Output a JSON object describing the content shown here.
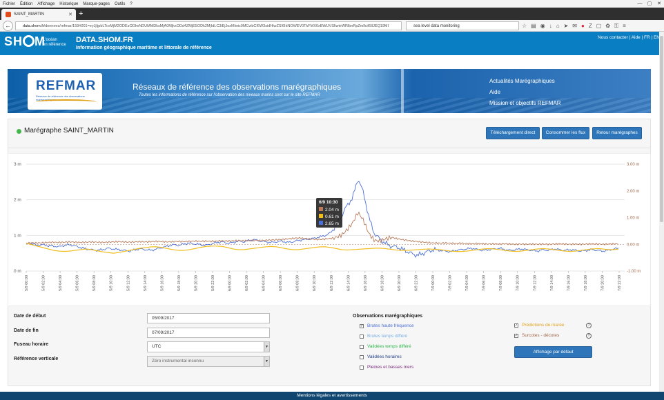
{
  "browser": {
    "menu": [
      "Fichier",
      "Édition",
      "Affichage",
      "Historique",
      "Marque-pages",
      "Outils",
      "?"
    ],
    "tab_title": "SAINT_MARTIN",
    "url_domain": "data.shom.fr",
    "url_rest": "/donnees/refmar/159#001=eyJjIjpbLTcvMjM2ODEzODIwNDUMMDksMjA0MjkxODd4ZMjE5ODk2MjIdLC3iEjJoxMlwic0MCvibCI6W3sidHlwZSI6IkNOWEV0TkFMX0xBWUVSIiwieWRlbnRpZmllciI6IlJEQ19MI",
    "search_value": "sea level data monitoring"
  },
  "site": {
    "logo_left": "SH",
    "logo_right": "M",
    "tagline_1": "L'océan",
    "tagline_2": "en référence",
    "title": "DATA.SHOM.FR",
    "subtitle": "Information géographique maritime et littorale de référence",
    "toplinks": "Nous contacter | Aide | FR | EN"
  },
  "banner": {
    "logo": "REFMAR",
    "logo_small": "Réseaux de référence des observations marégraphiques",
    "title": "Réseaux de référence des observations marégraphiques",
    "subtitle": "Toutes les informations de référence sur l'observation des niveaux marins sont sur le site REFMAR",
    "menu": [
      "Actualités Marégraphiques",
      "Aide",
      "Mission et objectifs REFMAR"
    ]
  },
  "station": {
    "title": "Marégraphe SAINT_MARTIN",
    "btn_download": "Téléchargement direct",
    "btn_flux": "Consommer les flux",
    "btn_back": "Retour marégraphes"
  },
  "chart_data": {
    "type": "line",
    "y_left_ticks": [
      "0 m",
      "1 m",
      "2 m",
      "3 m"
    ],
    "y_left_range": [
      0,
      3
    ],
    "y_right_ticks": [
      "-1.00 m",
      "0.00 m",
      "1.00 m",
      "2.00 m",
      "3.00 m"
    ],
    "y_right_range": [
      -1,
      3
    ],
    "x_ticks": [
      "5/9 00:00",
      "5/9 02:00",
      "5/9 04:00",
      "5/9 06:00",
      "5/9 08:00",
      "5/9 10:00",
      "5/9 12:00",
      "5/9 14:00",
      "5/9 16:00",
      "5/9 18:00",
      "5/9 20:00",
      "5/9 22:00",
      "6/9 00:00",
      "6/9 02:00",
      "6/9 04:00",
      "6/9 06:00",
      "6/9 08:00",
      "6/9 10:00",
      "6/9 12:00",
      "6/9 14:00",
      "6/9 16:00",
      "6/9 18:00",
      "6/9 20:00",
      "6/9 22:00",
      "7/9 00:00",
      "7/9 02:00",
      "7/9 04:00",
      "7/9 06:00",
      "7/9 08:00",
      "7/9 10:00",
      "7/9 12:00",
      "7/9 14:00",
      "7/9 16:00",
      "7/9 18:00",
      "7/9 20:00",
      "7/9 22:00"
    ],
    "series": [
      {
        "color": "#4a6fd8",
        "note": "hourly samples, left axis m",
        "values": [
          0.75,
          0.78,
          0.72,
          0.74,
          0.71,
          0.7,
          0.68,
          0.72,
          0.74,
          0.7,
          0.66,
          0.62,
          0.6,
          0.58,
          0.6,
          0.64,
          0.62,
          0.6,
          0.58,
          0.56,
          0.6,
          0.62,
          0.6,
          0.58,
          0.62,
          0.66,
          0.7,
          0.74,
          0.72,
          0.76,
          0.78,
          0.76,
          0.74,
          0.72,
          0.76,
          0.8,
          0.82,
          0.78,
          0.8,
          0.84,
          0.82,
          0.86,
          0.88,
          0.84,
          0.82,
          0.8,
          0.82,
          0.84,
          0.8,
          0.82,
          0.86,
          0.88,
          0.9,
          0.92,
          0.96,
          1.0,
          1.08,
          1.3,
          1.55,
          1.85,
          2.05,
          2.6,
          2.2,
          1.5,
          1.05,
          0.9,
          0.78,
          0.7,
          0.68,
          0.62,
          0.55,
          0.48,
          0.44,
          0.5,
          0.56,
          0.6,
          0.58,
          0.56,
          0.54,
          0.58,
          0.6,
          0.62,
          0.64,
          0.6,
          0.58,
          0.6,
          0.62,
          0.64,
          0.6,
          0.58,
          0.6,
          0.62,
          0.6,
          0.58,
          0.56,
          0.6,
          0.58,
          0.62,
          0.6,
          0.58,
          0.6,
          0.58,
          0.56,
          0.58,
          0.6,
          0.58,
          0.56,
          0.58,
          0.62,
          0.64
        ]
      },
      {
        "color": "#b87a5a",
        "note": "hourly samples, right axis m",
        "values": [
          0.04,
          0.06,
          0.05,
          0.06,
          0.07,
          0.08,
          0.07,
          0.08,
          0.09,
          0.08,
          0.07,
          0.08,
          0.09,
          0.08,
          0.07,
          0.08,
          0.09,
          0.1,
          0.09,
          0.08,
          0.09,
          0.1,
          0.09,
          0.1,
          0.11,
          0.1,
          0.09,
          0.1,
          0.11,
          0.1,
          0.11,
          0.12,
          0.11,
          0.12,
          0.11,
          0.12,
          0.13,
          0.12,
          0.13,
          0.14,
          0.13,
          0.14,
          0.15,
          0.14,
          0.15,
          0.16,
          0.17,
          0.18,
          0.2,
          0.22,
          0.24,
          0.22,
          0.2,
          0.19,
          0.18,
          0.2,
          0.22,
          0.26,
          0.35,
          0.55,
          0.8,
          1.2,
          0.9,
          0.4,
          0.15,
          0.12,
          0.2,
          0.25,
          0.22,
          0.18,
          0.15,
          0.12,
          0.1,
          0.08,
          0.06,
          0.05,
          0.04,
          0.05,
          0.04,
          0.03,
          0.04,
          0.03,
          0.02,
          0.03,
          0.02,
          0.01,
          0.02,
          0.01,
          0.02,
          0.01,
          0.0,
          0.01,
          0.0,
          0.01,
          0.0,
          0.01,
          0.0,
          0.01,
          0.02,
          0.01,
          0.0,
          0.01,
          0.0,
          0.01,
          0.02,
          0.01,
          0.0,
          0.01,
          0.02,
          0.01
        ]
      },
      {
        "color": "#f0bd1d",
        "note": "hourly samples, left axis m",
        "values": [
          0.78,
          0.74,
          0.7,
          0.66,
          0.62,
          0.58,
          0.56,
          0.55,
          0.56,
          0.58,
          0.6,
          0.62,
          0.6,
          0.57,
          0.54,
          0.52,
          0.5,
          0.52,
          0.55,
          0.58,
          0.61,
          0.64,
          0.66,
          0.68,
          0.68,
          0.66,
          0.63,
          0.6,
          0.58,
          0.58,
          0.6,
          0.63,
          0.66,
          0.69,
          0.7,
          0.7,
          0.69,
          0.66,
          0.62,
          0.6,
          0.6,
          0.62,
          0.64,
          0.66,
          0.68,
          0.69,
          0.68,
          0.65,
          0.62,
          0.6,
          0.6,
          0.62,
          0.64,
          0.66,
          0.68,
          0.68,
          0.66,
          0.63,
          0.6,
          0.59,
          0.6,
          0.61,
          0.62,
          0.63,
          0.64,
          0.64,
          0.63,
          0.61,
          0.59,
          0.58,
          0.58,
          0.59,
          0.6,
          0.61,
          0.62,
          0.61,
          0.6,
          0.58,
          0.56,
          0.55,
          0.55,
          0.56,
          0.58,
          0.6,
          0.62,
          0.63,
          0.62,
          0.6,
          0.58,
          0.56,
          0.55,
          0.56,
          0.58,
          0.6,
          0.62,
          0.63,
          0.62,
          0.6,
          0.58,
          0.56,
          0.55,
          0.56,
          0.58,
          0.6,
          0.62,
          0.63,
          0.62,
          0.6,
          0.6,
          0.62
        ]
      }
    ],
    "tooltip": {
      "title": "6/9 10:30",
      "rows": [
        {
          "color": "#b87a5a",
          "value": "2.04 m"
        },
        {
          "color": "#f0bd1d",
          "value": "0.61 m"
        },
        {
          "color": "#4a6fd8",
          "value": "2.65 m"
        }
      ]
    }
  },
  "form": {
    "start_label": "Date de début",
    "start_value": "05/09/2017",
    "end_label": "Date de fin",
    "end_value": "07/09/2017",
    "tz_label": "Fuseau horaire",
    "tz_value": "UTC",
    "ref_label": "Référence verticale",
    "ref_value": "Zéro instrumental inconnu"
  },
  "observations": {
    "title": "Observations marégraphiques",
    "items": [
      {
        "label": "Brutes haute fréquence",
        "color": "#4a6fd8",
        "checked": true
      },
      {
        "label": "Brutes temps différé",
        "color": "#7ab0e6",
        "checked": false
      },
      {
        "label": "Validées temps différé",
        "color": "#2db84a",
        "checked": false
      },
      {
        "label": "Validées horaires",
        "color": "#1d3f8a",
        "checked": false
      },
      {
        "label": "Pleines et basses mers",
        "color": "#7a2c7a",
        "checked": false
      }
    ],
    "extra": [
      {
        "label": "Prédictions de marée",
        "color": "#e0a21b",
        "checked": true
      },
      {
        "label": "Surcotes - décotes",
        "color": "#a0674a",
        "checked": true
      }
    ],
    "btn_default": "Affichage par défaut"
  },
  "footer": "Mentions légales et avertissements"
}
